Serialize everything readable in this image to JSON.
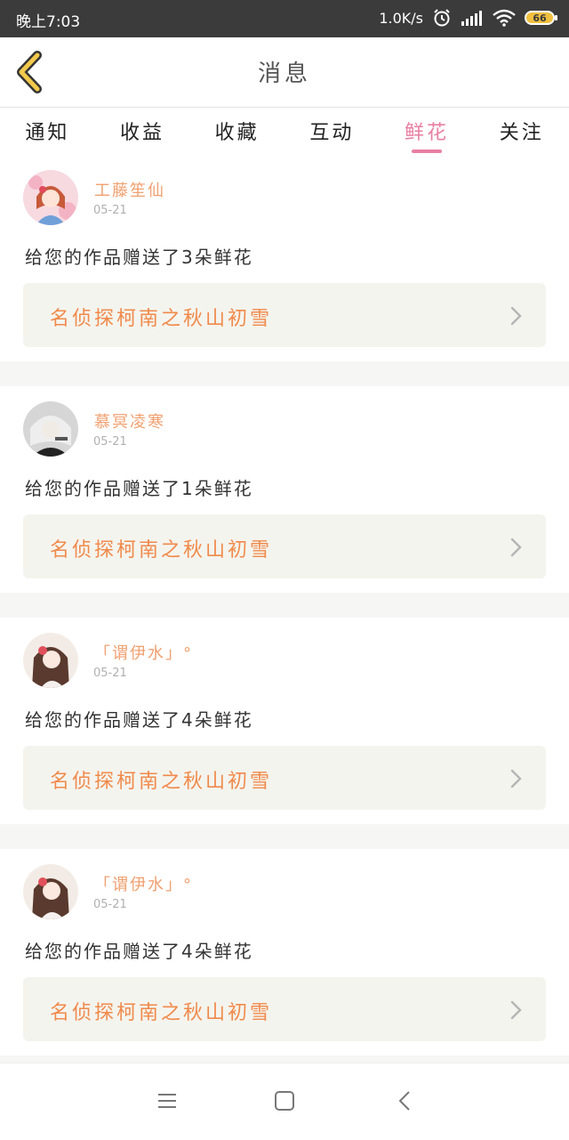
{
  "status_bar": {
    "time": "晚上7:03",
    "net_speed": "1.0K/s",
    "battery": "66",
    "icons": [
      "alarm-icon",
      "signal-icon",
      "wifi-icon",
      "battery-icon"
    ]
  },
  "header": {
    "title": "消息",
    "back_icon": "chevron-left-icon",
    "accent": "#f2c94c"
  },
  "tabs": [
    {
      "label": "通知",
      "active": false
    },
    {
      "label": "收益",
      "active": false
    },
    {
      "label": "收藏",
      "active": false
    },
    {
      "label": "互动",
      "active": false
    },
    {
      "label": "鲜花",
      "active": true
    },
    {
      "label": "关注",
      "active": false
    }
  ],
  "colors": {
    "active_tab": "#e87fa3",
    "username": "#f0a070",
    "work_title": "#f08a4b"
  },
  "messages": [
    {
      "user": "工藤笙仙",
      "date": "05-21",
      "text": "给您的作品赠送了3朵鲜花",
      "work": "名侦探柯南之秋山初雪"
    },
    {
      "user": "慕冥凌寒",
      "date": "05-21",
      "text": "给您的作品赠送了1朵鲜花",
      "work": "名侦探柯南之秋山初雪"
    },
    {
      "user": "「谓伊水」°",
      "date": "05-21",
      "text": "给您的作品赠送了4朵鲜花",
      "work": "名侦探柯南之秋山初雪"
    },
    {
      "user": "「谓伊水」°",
      "date": "05-21",
      "text": "给您的作品赠送了4朵鲜花",
      "work": "名侦探柯南之秋山初雪"
    }
  ],
  "nav": [
    "menu-icon",
    "home-square-icon",
    "back-chevron-icon"
  ]
}
